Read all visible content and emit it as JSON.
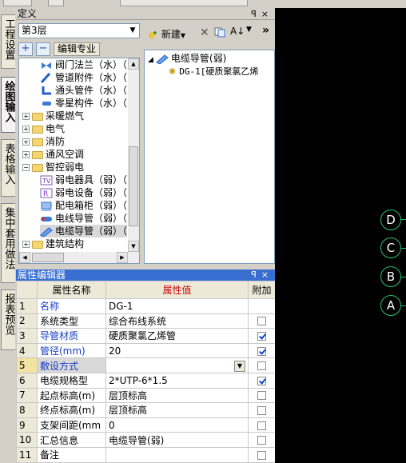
{
  "left_tabs": [
    "工程设置",
    "绘图输入",
    "表格输入",
    "集中套用做法",
    "报表预览"
  ],
  "active_left_tab": "绘图输入",
  "definition_panel": {
    "title": "定义",
    "controls": [
      "ꟼ",
      "×"
    ],
    "floor": "第3层",
    "toolbar": {
      "add": "+",
      "remove": "−",
      "edit_spec": "编辑专业"
    },
    "tree": [
      {
        "label": "阀门法兰（水）（",
        "icon": "valve-icon",
        "level": 2
      },
      {
        "label": "管道附件（水）（",
        "icon": "pipe-fitting-icon",
        "level": 2
      },
      {
        "label": "通头管件（水）（",
        "icon": "tee-fitting-icon",
        "level": 2
      },
      {
        "label": "零星构件（水）（",
        "icon": "misc-component-icon",
        "level": 2
      },
      {
        "label": "采暖燃气",
        "icon": "folder-icon",
        "level": 1,
        "expander": "+"
      },
      {
        "label": "电气",
        "icon": "folder-icon",
        "level": 1,
        "expander": "+"
      },
      {
        "label": "消防",
        "icon": "folder-icon",
        "level": 1,
        "expander": "+"
      },
      {
        "label": "通风空调",
        "icon": "folder-icon",
        "level": 1,
        "expander": "+"
      },
      {
        "label": "智控弱电",
        "icon": "folder-icon",
        "level": 1,
        "expander": "−"
      },
      {
        "label": "弱电器具（弱）（",
        "icon": "tv-icon",
        "level": 2
      },
      {
        "label": "弱电设备（弱）（",
        "icon": "r-device-icon",
        "level": 2
      },
      {
        "label": "配电箱柜（弱）（",
        "icon": "cabinet-icon",
        "level": 2
      },
      {
        "label": "电线导管（弱）（",
        "icon": "wire-icon",
        "level": 2
      },
      {
        "label": "电缆导管（弱）（",
        "icon": "cable-conduit-icon",
        "level": 2,
        "selected": true
      },
      {
        "label": "建筑结构",
        "icon": "folder-icon",
        "level": 1,
        "expander": "+"
      }
    ]
  },
  "right_panel": {
    "new_label": "新建",
    "tree": [
      {
        "label": "电缆导管(弱)",
        "level": 1
      },
      {
        "label": "DG-1[硬质聚氯乙烯",
        "level": 2
      }
    ]
  },
  "properties": {
    "title": "属性编辑器",
    "headers": {
      "name": "属性名称",
      "value": "属性值",
      "extra": "附加"
    },
    "rows": [
      {
        "num": "1",
        "name": "名称",
        "value": "DG-1",
        "blue": true,
        "check": null
      },
      {
        "num": "2",
        "name": "系统类型",
        "value": "综合布线系统",
        "blue": false,
        "check": false
      },
      {
        "num": "3",
        "name": "导管材质",
        "value": "硬质聚氯乙烯管",
        "blue": true,
        "check": true
      },
      {
        "num": "4",
        "name": "管径(mm)",
        "value": "20",
        "blue": true,
        "check": true
      },
      {
        "num": "5",
        "name": "敷设方式",
        "value": "",
        "blue": true,
        "check": false,
        "dropdown": true,
        "selected": true
      },
      {
        "num": "6",
        "name": "电缆规格型",
        "value": "2*UTP-6*1.5",
        "blue": false,
        "check": true
      },
      {
        "num": "7",
        "name": "起点标高(m)",
        "value": "层顶标高",
        "blue": false,
        "check": false
      },
      {
        "num": "8",
        "name": "终点标高(m)",
        "value": "层顶标高",
        "blue": false,
        "check": false
      },
      {
        "num": "9",
        "name": "支架间距(mm",
        "value": "0",
        "blue": false,
        "check": false
      },
      {
        "num": "10",
        "name": "汇总信息",
        "value": "电缆导管(弱)",
        "blue": false,
        "check": false
      },
      {
        "num": "11",
        "name": "备注",
        "value": "",
        "blue": false,
        "check": false
      }
    ]
  },
  "canvas": {
    "background": "#000000",
    "axis_color": "#28c070",
    "axes": [
      "D",
      "C",
      "B",
      "A"
    ]
  }
}
